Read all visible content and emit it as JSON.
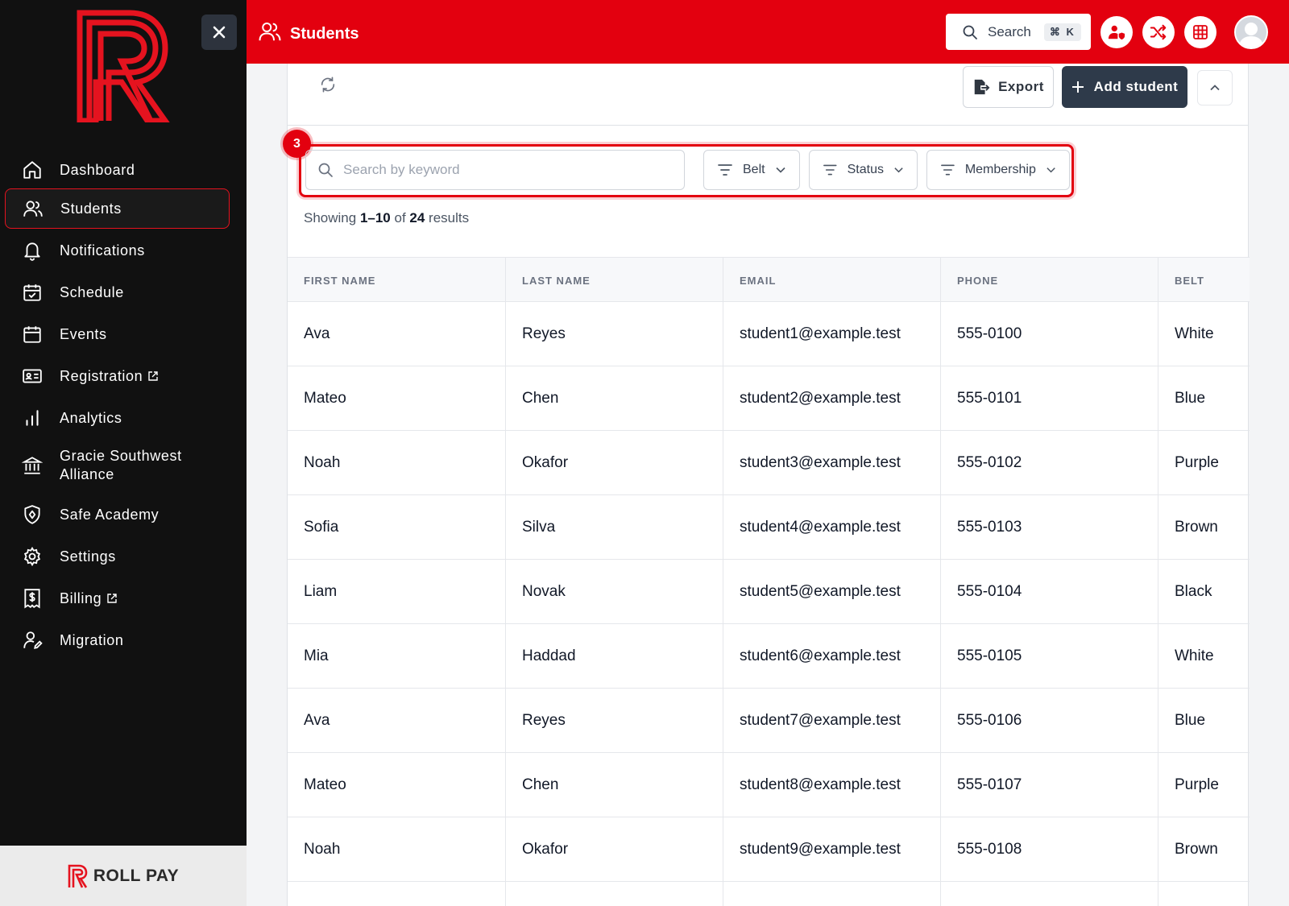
{
  "sidebar": {
    "items": [
      {
        "label": "Dashboard",
        "icon": "home-icon"
      },
      {
        "label": "Students",
        "icon": "users-icon",
        "active": true
      },
      {
        "label": "Notifications",
        "icon": "bell-icon"
      },
      {
        "label": "Schedule",
        "icon": "calendar-check-icon"
      },
      {
        "label": "Events",
        "icon": "calendar-icon"
      },
      {
        "label": "Registration",
        "icon": "id-card-icon",
        "external": true
      },
      {
        "label": "Analytics",
        "icon": "bar-chart-icon"
      },
      {
        "label": "Gracie Southwest",
        "label2": "Alliance",
        "icon": "bank-icon"
      },
      {
        "label": "Safe Academy",
        "icon": "shield-icon"
      },
      {
        "label": "Settings",
        "icon": "gear-icon"
      },
      {
        "label": "Billing",
        "icon": "invoice-icon",
        "external": true
      },
      {
        "label": "Migration",
        "icon": "user-edit-icon"
      }
    ],
    "footer_brand": "ROLL PAY"
  },
  "header": {
    "title": "Students",
    "search_label": "Search",
    "search_shortcut": "⌘ K"
  },
  "toolbar": {
    "export_label": "Export",
    "add_label": "Add student"
  },
  "filters": {
    "step_number": "3",
    "keyword_placeholder": "Search by keyword",
    "belt_label": "Belt",
    "status_label": "Status",
    "membership_label": "Membership"
  },
  "results": {
    "prefix": "Showing ",
    "range": "1–10",
    "middle": " of ",
    "total": "24",
    "suffix": " results"
  },
  "table": {
    "columns": [
      "FIRST NAME",
      "LAST NAME",
      "EMAIL",
      "PHONE",
      "BELT"
    ],
    "rows": [
      [
        "Ava",
        "Reyes",
        "student1@example.test",
        "555-0100",
        "White"
      ],
      [
        "Mateo",
        "Chen",
        "student2@example.test",
        "555-0101",
        "Blue"
      ],
      [
        "Noah",
        "Okafor",
        "student3@example.test",
        "555-0102",
        "Purple"
      ],
      [
        "Sofia",
        "Silva",
        "student4@example.test",
        "555-0103",
        "Brown"
      ],
      [
        "Liam",
        "Novak",
        "student5@example.test",
        "555-0104",
        "Black"
      ],
      [
        "Mia",
        "Haddad",
        "student6@example.test",
        "555-0105",
        "White"
      ],
      [
        "Ava",
        "Reyes",
        "student7@example.test",
        "555-0106",
        "Blue"
      ],
      [
        "Mateo",
        "Chen",
        "student8@example.test",
        "555-0107",
        "Purple"
      ],
      [
        "Noah",
        "Okafor",
        "student9@example.test",
        "555-0108",
        "Brown"
      ],
      [
        "",
        "",
        "",
        "",
        ""
      ]
    ]
  },
  "colors": {
    "brand_red": "#e3000f",
    "sidebar_bg": "#111111",
    "primary_button": "#2e3a4a"
  }
}
